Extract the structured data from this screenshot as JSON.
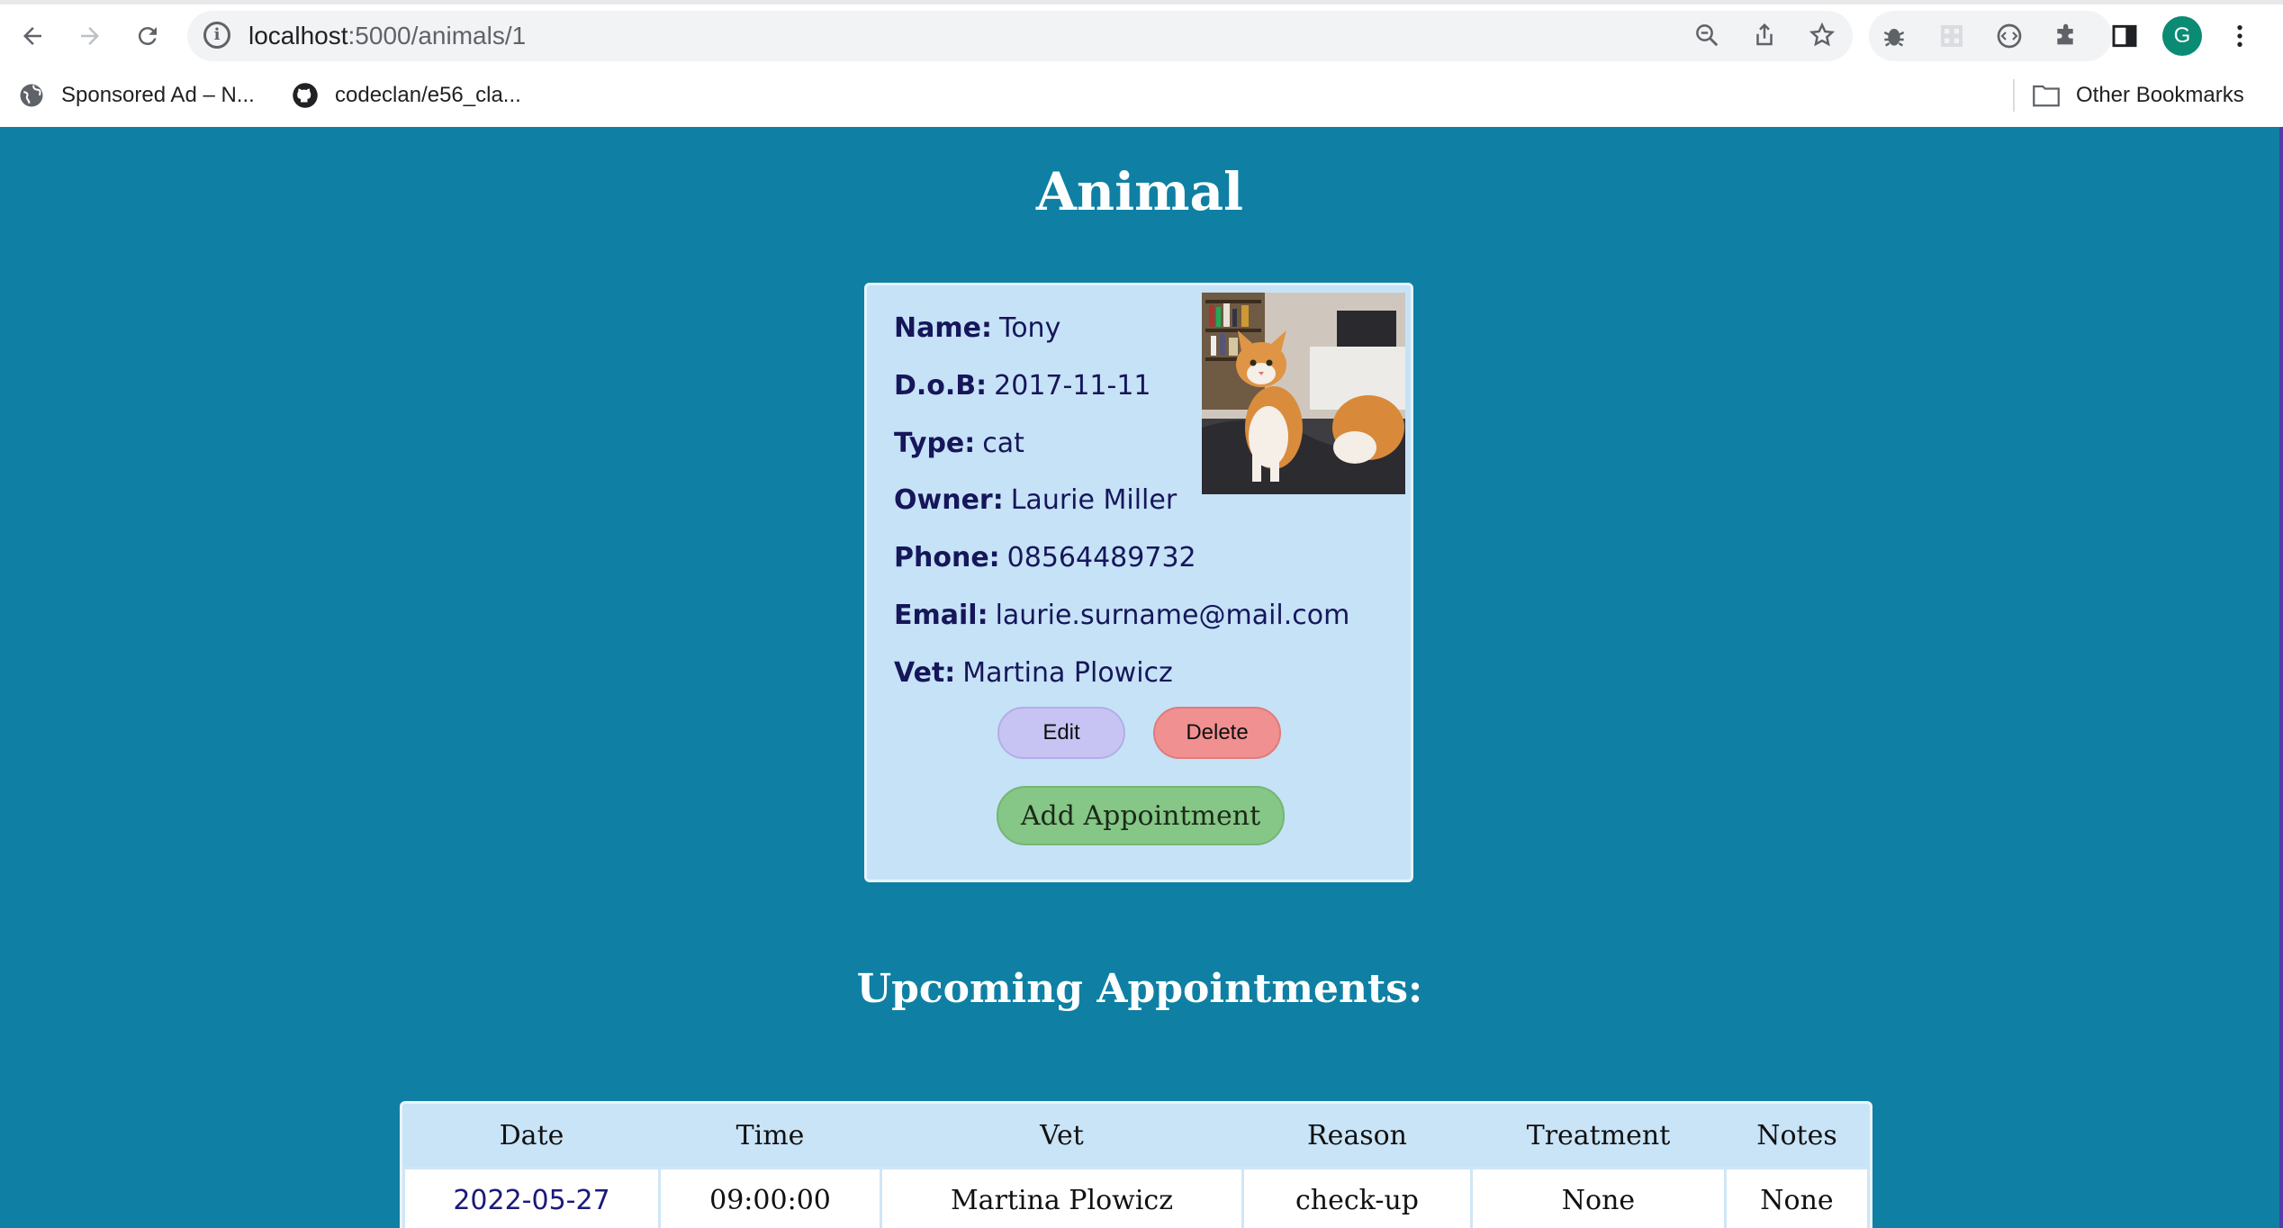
{
  "browser": {
    "url_host": "localhost",
    "url_path": ":5000/animals/1",
    "avatar_letter": "G",
    "bookmarks": [
      {
        "label": "Sponsored Ad – N...",
        "icon": "globe-icon"
      },
      {
        "label": "codeclan/e56_cla...",
        "icon": "github-icon"
      }
    ],
    "other_bookmarks": "Other Bookmarks"
  },
  "page": {
    "title": "Animal",
    "animal": {
      "name_label": "Name:",
      "name": "Tony",
      "dob_label": "D.o.B:",
      "dob": "2017-11-11",
      "type_label": "Type:",
      "type": "cat",
      "owner_label": "Owner:",
      "owner": "Laurie Miller",
      "phone_label": "Phone:",
      "phone": "08564489732",
      "email_label": "Email:",
      "email": "laurie.surname@mail.com",
      "vet_label": "Vet:",
      "vet": "Martina Plowicz"
    },
    "buttons": {
      "edit": "Edit",
      "delete": "Delete",
      "add_appointment": "Add Appointment"
    },
    "appointments_title": "Upcoming Appointments:",
    "appointments": {
      "headers": [
        "Date",
        "Time",
        "Vet",
        "Reason",
        "Treatment",
        "Notes"
      ],
      "rows": [
        [
          "2022-05-27",
          "09:00:00",
          "Martina Plowicz",
          "check-up",
          "None",
          "None"
        ]
      ]
    }
  },
  "colors": {
    "page_bg": "#0f80a3",
    "card_bg": "#c6e2f7",
    "edit_btn": "#c7c3f3",
    "delete_btn": "#f09090",
    "add_btn": "#86c686"
  }
}
